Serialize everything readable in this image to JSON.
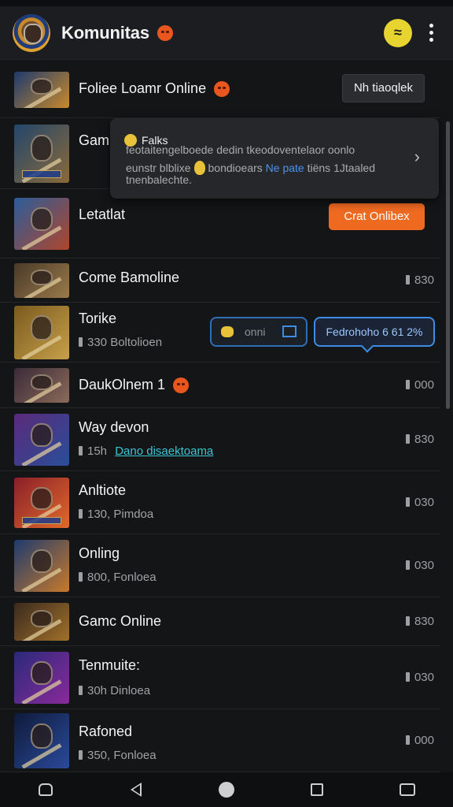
{
  "header": {
    "title": "Komunitas",
    "logo_icon": "game-emblem-icon",
    "title_emoji_icon": "angry-emoji-icon",
    "action_icon": "smile-face-icon",
    "menu_icon": "more-vertical-icon"
  },
  "rows": [
    {
      "name": "Foliee Loamr Online",
      "meta": "",
      "link": "",
      "count": "",
      "button": "Nh tiaoqlek",
      "button_style": "dark",
      "has_emoji": true,
      "colors": [
        "#1e3a6e",
        "#c98a2b"
      ]
    },
    {
      "name": "Gamr",
      "meta": "",
      "link": "",
      "count": "",
      "button": "",
      "button_style": "",
      "has_emoji": false,
      "colors": [
        "#23466b",
        "#8a6a3a"
      ]
    },
    {
      "name": "Letatlat",
      "meta": "",
      "link": "",
      "count": "",
      "button": "Crat Onlibex",
      "button_style": "orange",
      "has_emoji": false,
      "colors": [
        "#2a5d9a",
        "#b0452c"
      ]
    },
    {
      "name": "Come Bamoline",
      "meta": "",
      "link": "",
      "count": "830",
      "button": "",
      "button_style": "",
      "has_emoji": false,
      "colors": [
        "#4a3a2a",
        "#9a7a4a"
      ]
    },
    {
      "name": "Torike",
      "meta": "330",
      "meta_suffix": "Boltolioen",
      "link": "",
      "count": "",
      "button": "",
      "button_style": "",
      "has_emoji": false,
      "colors": [
        "#7a5a1e",
        "#c7a04a"
      ]
    },
    {
      "name": "DaukOlnem 1",
      "meta": "",
      "link": "",
      "count": "000",
      "button": "",
      "button_style": "",
      "has_emoji": true,
      "colors": [
        "#3a2a38",
        "#8b6a5a"
      ]
    },
    {
      "name": "Way devon",
      "meta": "15h",
      "meta_suffix": "",
      "link": "Dano disaektoama",
      "count": "830",
      "button": "",
      "button_style": "",
      "has_emoji": false,
      "colors": [
        "#5a2a7a",
        "#2a4e9a"
      ]
    },
    {
      "name": "Anltiote",
      "meta": "130,",
      "meta_suffix": "Pimdoa",
      "link": "",
      "count": "030",
      "button": "",
      "button_style": "",
      "has_emoji": false,
      "colors": [
        "#8a1e2a",
        "#e06a2a"
      ]
    },
    {
      "name": "Onling",
      "meta": "800,",
      "meta_suffix": "Fonloea",
      "link": "",
      "count": "030",
      "button": "",
      "button_style": "",
      "has_emoji": false,
      "colors": [
        "#1e3a6e",
        "#c87a2a"
      ]
    },
    {
      "name": "Gamc Online",
      "meta": "",
      "link": "",
      "count": "830",
      "button": "",
      "button_style": "",
      "has_emoji": false,
      "colors": [
        "#3a2a1e",
        "#a0702a"
      ]
    },
    {
      "name": "Tenmuite:",
      "meta": "30h",
      "meta_suffix": "Dinloea",
      "link": "",
      "count": "030",
      "button": "",
      "button_style": "",
      "has_emoji": false,
      "colors": [
        "#2a2a7a",
        "#8a2a9a"
      ]
    },
    {
      "name": "Rafoned",
      "meta": "350,",
      "meta_suffix": "Fonloea",
      "link": "",
      "count": "000",
      "button": "",
      "button_style": "",
      "has_emoji": false,
      "colors": [
        "#0e1a3a",
        "#2a4a9a"
      ]
    }
  ],
  "popup": {
    "title": "Falks",
    "line1": "feotaitengelboede dedin tkeodoventelaor oonlo",
    "line2_a": "eunstr blblixe",
    "line2_b": "bondioears",
    "line2_highlight": "Ne pate",
    "line2_c": "tiëns 1Jtaaled",
    "line3": "tnenbalechte.",
    "chevron_icon": "chevron-right-icon"
  },
  "pills": {
    "group_text": "onni",
    "blue_text": "Fedrohoho 6 61 2%"
  },
  "navbar": {
    "items": [
      "home-outline-icon",
      "back-icon",
      "home-icon",
      "recents-icon",
      "screenshot-icon"
    ]
  },
  "colors": {
    "background": "#141517",
    "accent_orange": "#ee6a21",
    "accent_blue": "#3d8de6",
    "link_teal": "#3bc6d4"
  }
}
